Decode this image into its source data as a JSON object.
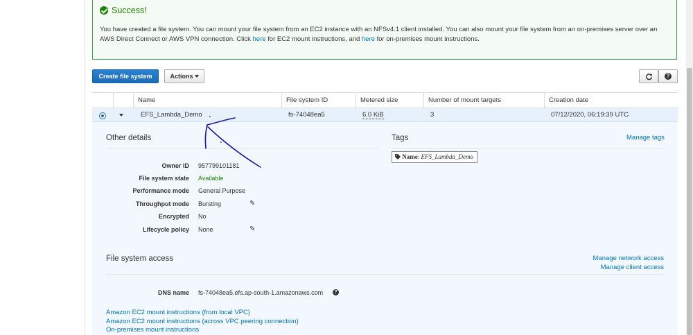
{
  "alert": {
    "title": "Success!",
    "body_part1": "You have created a file system. You can mount your file system from an EC2 instance with an NFSv4.1 client installed. You can also mount your file system from an on-premises server over an AWS Direct Connect or AWS VPN connection. Click ",
    "link1": "here",
    "body_part2": " for EC2 mount instructions, and ",
    "link2": "here",
    "body_part3": " for on-premises mount instructions."
  },
  "toolbar": {
    "create_label": "Create file system",
    "actions_label": "Actions",
    "help_label": "?"
  },
  "table": {
    "columns": [
      "Name",
      "File system ID",
      "Metered size",
      "Number of mount targets",
      "Creation date"
    ],
    "row": {
      "name": "EFS_Lambda_Demo",
      "id": "fs-74048ea5",
      "size": "6.0 KiB",
      "mount_targets": "3",
      "created": "07/12/2020, 06:19:39 UTC"
    }
  },
  "details": {
    "other_title": "Other details",
    "tags_title": "Tags",
    "manage_tags": "Manage tags",
    "tag_key": "Name",
    "tag_value": "EFS_Lambda_Demo",
    "fields": [
      {
        "label": "Owner ID",
        "value": "957799101181"
      },
      {
        "label": "File system state",
        "value": "Available"
      },
      {
        "label": "Performance mode",
        "value": "General Purpose"
      },
      {
        "label": "Throughput mode",
        "value": "Bursting"
      },
      {
        "label": "Encrypted",
        "value": "No"
      },
      {
        "label": "Lifecycle policy",
        "value": "None"
      }
    ],
    "access_title": "File system access",
    "manage_network": "Manage network access",
    "manage_client": "Manage client access",
    "dns_label": "DNS name",
    "dns_value": "fs-74048ea5.efs.ap-south-1.amazonaws.com",
    "links": [
      "Amazon EC2 mount instructions (from local VPC)",
      "Amazon EC2 mount instructions (across VPC peering connection)",
      "On-premises mount instructions"
    ]
  },
  "colors": {
    "success": "#1d8102",
    "link": "#0073bb",
    "primary": "#1a6cb8",
    "annotation": "#1a1a9e"
  },
  "icons": [
    "check-circle-icon",
    "caret-down-icon",
    "refresh-icon",
    "help-icon",
    "tag-icon",
    "pencil-icon",
    "radio-selected-icon"
  ]
}
